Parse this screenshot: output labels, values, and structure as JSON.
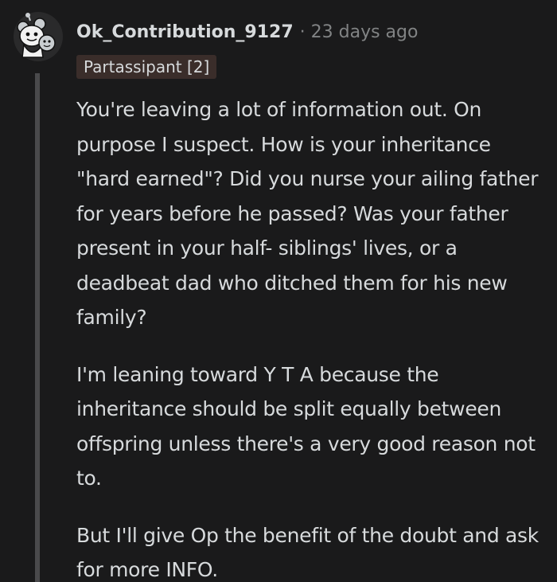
{
  "comment": {
    "author": "Ok_Contribution_9127",
    "separator": "·",
    "timestamp": "23 days ago",
    "flair": "Partassipant [2]",
    "avatar_icon": "snoo-avatar-icon",
    "paragraphs": [
      "You're leaving a lot of information out. On purpose I suspect. How is your inheritance \"hard earned\"? Did you nurse your ailing father for years before he passed? Was your father present in your half- siblings' lives, or a deadbeat dad who ditched them for his new family?",
      "I'm leaning toward Y T A because the inheritance should be split equally between offspring unless there's a very good reason not to.",
      "But I'll give Op the benefit of the doubt and ask for more INFO."
    ]
  },
  "colors": {
    "background": "#1a1a1b",
    "text": "#d7dadc",
    "muted": "#818384",
    "flair_bg": "#3a2d2a",
    "thread_line": "#4a4a4c"
  }
}
